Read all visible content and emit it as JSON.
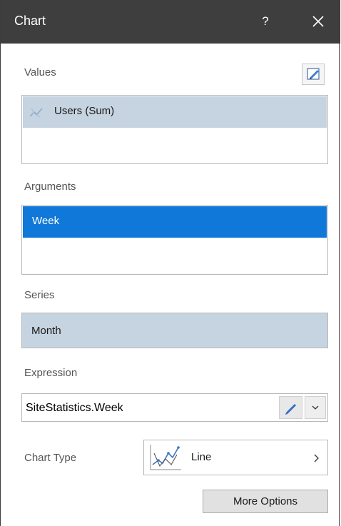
{
  "window": {
    "title": "Chart",
    "help_label": "?"
  },
  "values": {
    "label": "Values",
    "items": [
      {
        "label": "Users (Sum)",
        "icon": "line-series-icon"
      }
    ]
  },
  "arguments": {
    "label": "Arguments",
    "items": [
      {
        "label": "Week",
        "selected": true
      }
    ]
  },
  "series": {
    "label": "Series",
    "value": "Month"
  },
  "expression": {
    "label": "Expression",
    "value": "SiteStatistics.Week"
  },
  "chart_type": {
    "label": "Chart Type",
    "value": "Line",
    "icon": "line-chart-icon"
  },
  "buttons": {
    "more_options": "More Options"
  },
  "colors": {
    "titlebar": "#3e3e3e",
    "selection": "#0f78d8",
    "item_background": "#c6d3e0"
  }
}
